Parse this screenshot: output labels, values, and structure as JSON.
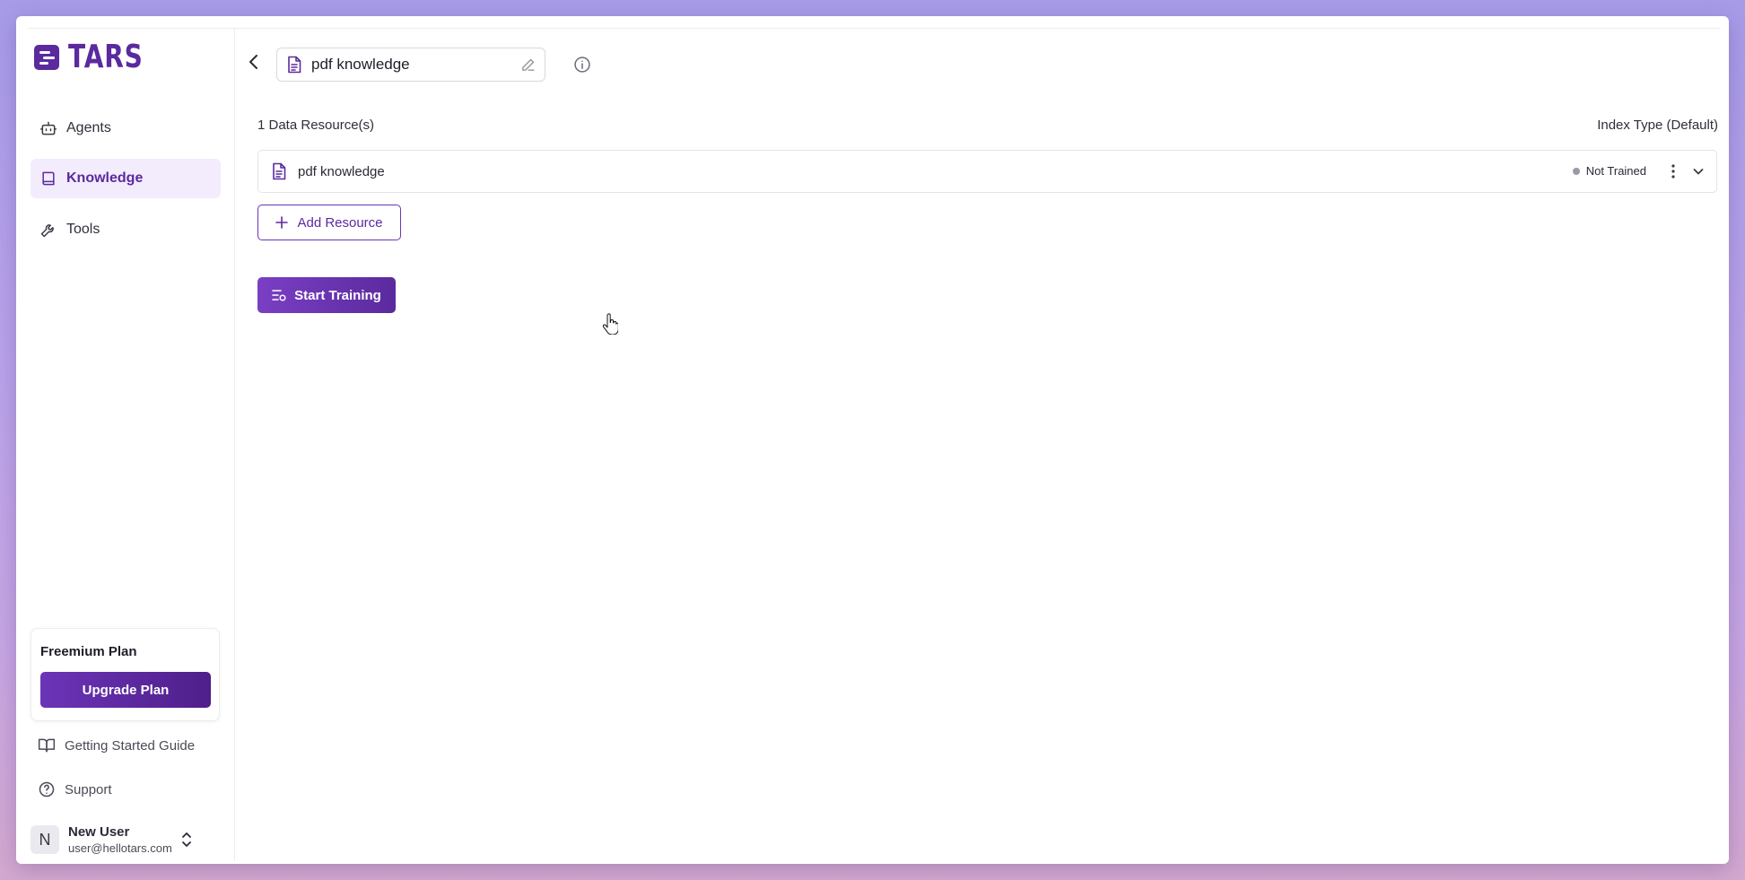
{
  "brand": {
    "name": "TARS",
    "color": "#5b2a9e"
  },
  "sidebar": {
    "items": [
      {
        "label": "Agents",
        "icon": "bot-icon",
        "active": false
      },
      {
        "label": "Knowledge",
        "icon": "book-icon",
        "active": true
      },
      {
        "label": "Tools",
        "icon": "wrench-icon",
        "active": false
      }
    ],
    "plan": {
      "title": "Freemium Plan",
      "button_label": "Upgrade Plan"
    },
    "links": [
      {
        "label": "Getting Started Guide",
        "icon": "open-book-icon"
      },
      {
        "label": "Support",
        "icon": "help-circle-icon"
      }
    ],
    "user": {
      "initial": "N",
      "name": "New User",
      "email": "user@hellotars.com"
    }
  },
  "main": {
    "title_value": "pdf knowledge",
    "resource_count": "1 Data Resource(s)",
    "index_type": "Index Type (Default)",
    "resources": [
      {
        "name": "pdf knowledge",
        "status": "Not Trained",
        "status_color": "#9a9aa4"
      }
    ],
    "add_resource_label": "Add Resource",
    "start_training_label": "Start Training"
  }
}
